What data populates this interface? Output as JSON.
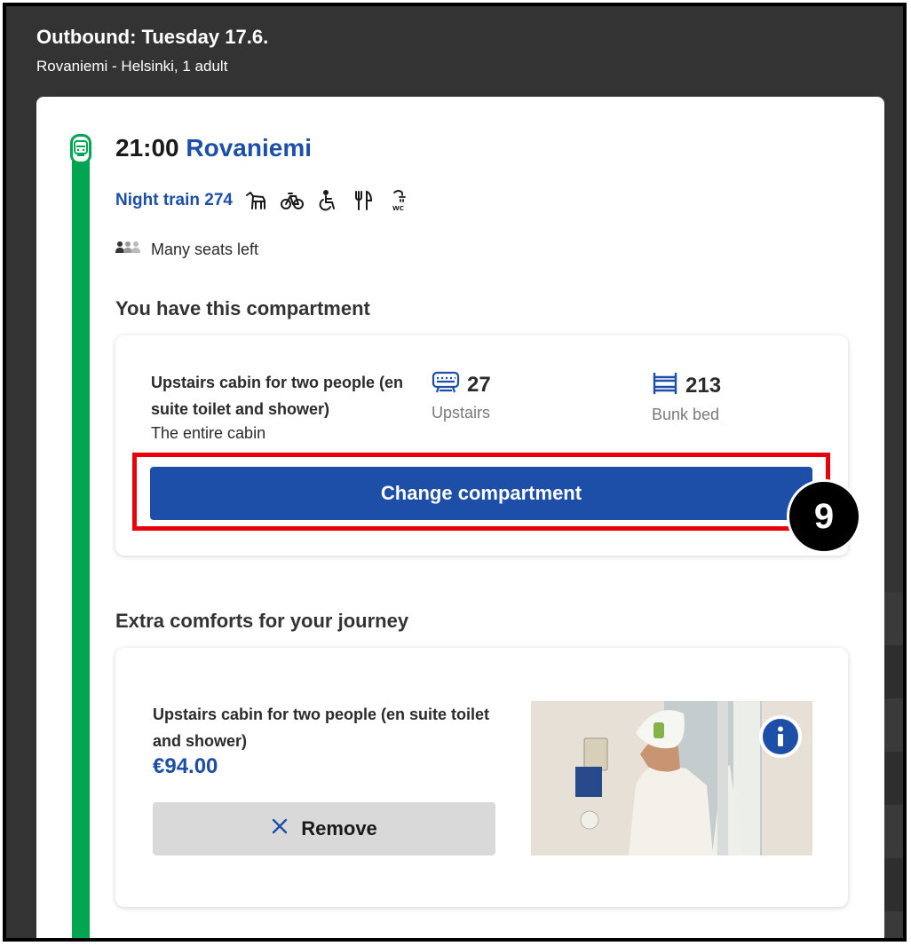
{
  "header": {
    "title": "Outbound: Tuesday 17.6.",
    "subtitle": "Rovaniemi - Helsinki, 1 adult"
  },
  "departure": {
    "time": "21:00",
    "station": "Rovaniemi",
    "train_label": "Night train 274",
    "services": [
      "pet-icon",
      "bicycle-icon",
      "wheelchair-icon",
      "restaurant-icon",
      "shower-wc-icon"
    ],
    "availability": "Many seats left"
  },
  "compartment": {
    "section_title": "You have this compartment",
    "cabin_name": "Upstairs cabin for two people (en suite toilet and shower)",
    "cabin_type": "The entire cabin",
    "car_number": "27",
    "car_label": "Upstairs",
    "bed_number": "213",
    "bed_label": "Bunk bed",
    "change_label": "Change compartment",
    "step_number": "9"
  },
  "extras": {
    "section_title": "Extra comforts for your journey",
    "item_name": "Upstairs cabin for two people (en suite toilet and shower)",
    "price": "€94.00",
    "remove_label": "Remove"
  },
  "colors": {
    "accent_blue": "#1d4fa8",
    "rail_green": "#00a651",
    "highlight_red": "#e8000b"
  }
}
